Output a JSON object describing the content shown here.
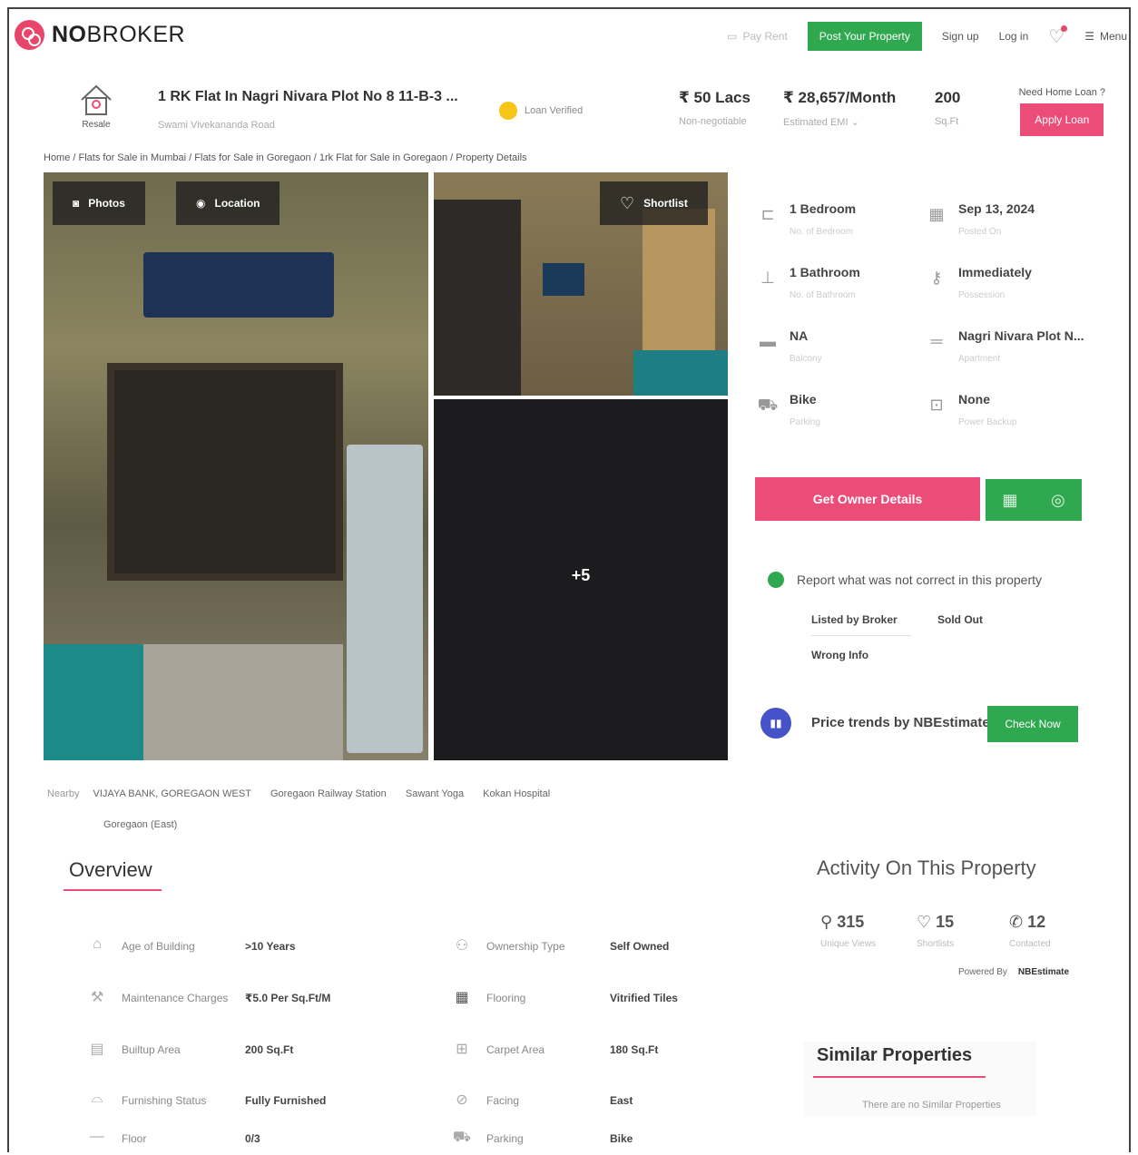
{
  "brand": {
    "name_bold": "NO",
    "name_rest": "BROKER",
    "accent": "#ec4c78",
    "green": "#2fa84f"
  },
  "nav": {
    "pay_rent": "Pay Rent",
    "post_property": "Post Your Property",
    "sign_up": "Sign up",
    "log_in": "Log in",
    "menu": "Menu"
  },
  "property": {
    "type_label": "Resale",
    "title": "1 RK Flat In Nagri Nivara Plot No 8 11-B-3 ...",
    "subtitle": "Swami Vivekananda Road",
    "loan_verified": "Loan Verified",
    "price": "₹ 50 Lacs",
    "price_note": "Non-negotiable",
    "emi": "₹ 28,657/Month",
    "emi_note": "Estimated EMI ⌄",
    "area": "200",
    "area_unit": "Sq.Ft",
    "home_loan_q": "Need Home Loan ?",
    "apply_loan": "Apply Loan"
  },
  "breadcrumb": "Home / Flats for Sale in Mumbai / Flats for Sale in Goregaon / 1rk Flat for Sale in Goregaon / Property Details",
  "gallery": {
    "photos": "Photos",
    "location": "Location",
    "shortlist": "Shortlist",
    "more": "+5"
  },
  "nearby": {
    "label": "Nearby",
    "places": [
      "VIJAYA BANK, GOREGAON WEST",
      "Goregaon Railway Station",
      "Sawant Yoga",
      "Kokan Hospital",
      "Goregaon (East)"
    ]
  },
  "details": [
    {
      "value": "1 Bedroom",
      "label": "No. of Bedroom",
      "icon": "bed-icon"
    },
    {
      "value": "Sep 13, 2024",
      "label": "Posted On",
      "icon": "calendar-icon"
    },
    {
      "value": "1 Bathroom",
      "label": "No. of Bathroom",
      "icon": "shower-icon"
    },
    {
      "value": "Immediately",
      "label": "Possession",
      "icon": "key-icon"
    },
    {
      "value": "NA",
      "label": "Balcony",
      "icon": "balcony-icon"
    },
    {
      "value": "Nagri Nivara Plot N...",
      "label": "Apartment",
      "icon": "building-icon"
    },
    {
      "value": "Bike",
      "label": "Parking",
      "icon": "car-icon"
    },
    {
      "value": "None",
      "label": "Power Backup",
      "icon": "battery-icon"
    }
  ],
  "actions": {
    "get_owner": "Get Owner Details"
  },
  "report": {
    "heading": "Report what was not correct in this property",
    "options": [
      "Listed by Broker",
      "Sold Out",
      "Wrong Info"
    ]
  },
  "price_trend": {
    "text": "Price trends by NBEstimate",
    "button": "Check Now"
  },
  "overview": {
    "title": "Overview",
    "left": [
      {
        "key": "Age of Building",
        "value": ">10 Years",
        "icon": "building-age-icon"
      },
      {
        "key": "Maintenance Charges",
        "value": "₹5.0 Per Sq.Ft/M",
        "icon": "tools-icon"
      },
      {
        "key": "Builtup Area",
        "value": "200 Sq.Ft",
        "icon": "area-icon"
      },
      {
        "key": "Furnishing Status",
        "value": "Fully Furnished",
        "icon": "sofa-icon"
      },
      {
        "key": "Floor",
        "value": "0/3",
        "icon": "floor-icon"
      }
    ],
    "right": [
      {
        "key": "Ownership Type",
        "value": "Self Owned",
        "icon": "owner-icon"
      },
      {
        "key": "Flooring",
        "value": "Vitrified Tiles",
        "icon": "tiles-icon"
      },
      {
        "key": "Carpet Area",
        "value": "180 Sq.Ft",
        "icon": "carpet-icon"
      },
      {
        "key": "Facing",
        "value": "East",
        "icon": "compass-icon"
      },
      {
        "key": "Parking",
        "value": "Bike",
        "icon": "car-icon"
      }
    ]
  },
  "activity": {
    "title": "Activity On This Property",
    "stats": [
      {
        "value": "315",
        "label": "Unique Views",
        "icon": "views-icon"
      },
      {
        "value": "15",
        "label": "Shortlists",
        "icon": "heart-icon"
      },
      {
        "value": "12",
        "label": "Contacted",
        "icon": "phone-icon"
      }
    ],
    "powered_by": "Powered By",
    "powered_name": "NBEstimate"
  },
  "similar": {
    "title": "Similar Properties",
    "empty": "There are no Similar Properties"
  }
}
